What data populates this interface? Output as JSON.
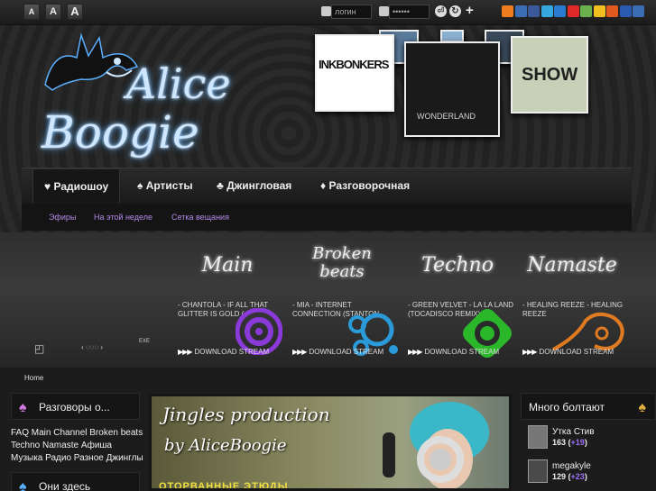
{
  "topbar": {
    "font_sizes": [
      "A",
      "A",
      "A"
    ],
    "login_placeholder": "логин",
    "password_placeholder": "••••••",
    "plus_label": "+",
    "social_colors": [
      "#f07c20",
      "#3b6db5",
      "#3b5998",
      "#35a8e0",
      "#2a7ad0",
      "#e02a2a",
      "#6ab04c",
      "#f0c020",
      "#e05a20",
      "#2a5ab0",
      "#3b6db5"
    ]
  },
  "header": {
    "logo_line1": "Alice",
    "logo_line2": "Boogie",
    "covers": [
      {
        "label": "INKBONKERS",
        "bg": "#ffffff",
        "fg": "#111111"
      },
      {
        "label": "WONDERLAND",
        "bg": "#1a1a1a",
        "fg": "#d0d0d0"
      },
      {
        "label": "SHOW",
        "bg": "#c8d0b8",
        "fg": "#202020"
      }
    ]
  },
  "nav": {
    "items": [
      {
        "icon": "♥",
        "label": "Радиошоу"
      },
      {
        "icon": "♠",
        "label": "Артисты"
      },
      {
        "icon": "♣",
        "label": "Джингловая"
      },
      {
        "icon": "♦",
        "label": "Разговорочная"
      }
    ],
    "sub": [
      "Эфиры",
      "На этой неделе",
      "Сетка вещания"
    ]
  },
  "band": {
    "controls": [
      "◰",
      "‹ ◌◌◌ ›",
      "EXE"
    ],
    "channels": [
      {
        "name": "Main",
        "track": "- CHANTOLA - IF ALL THAT GLITTER IS GOLD (",
        "dl": "DOWNLOAD STREAM",
        "color": "#8a3ad8"
      },
      {
        "name": "Broken beats",
        "track": "- MIA - INTERNET CONNECTION (STANTON",
        "dl": "DOWNLOAD STREAM",
        "color": "#2a9ad8"
      },
      {
        "name": "Techno",
        "track": "- GREEN VELVET - LA LA LAND (TOCADISCO REMIX)",
        "dl": "DOWNLOAD STREAM",
        "color": "#2ab82a"
      },
      {
        "name": "Namaste",
        "track": "- HEALING REEZE - HEALING REEZE",
        "dl": "DOWNLOAD STREAM",
        "color": "#e07a20"
      }
    ]
  },
  "crumb": "Home",
  "left": {
    "panel1": "Разговоры о...",
    "tags": "FAQ Main Channel Broken beats Techno Namaste Афиша Музыка Радио Разное Джинглы",
    "panel2": "Они здесь"
  },
  "banner": {
    "line1": "Jingles production",
    "line2": "by AliceBoogie",
    "line3": "ОТОРВАННЫЕ ЭТЮДЫ"
  },
  "right": {
    "title": "Много болтают",
    "users": [
      {
        "name": "Утка Стив",
        "score": "163",
        "delta": "+19"
      },
      {
        "name": "megakyle",
        "score": "129",
        "delta": "+23"
      }
    ]
  }
}
